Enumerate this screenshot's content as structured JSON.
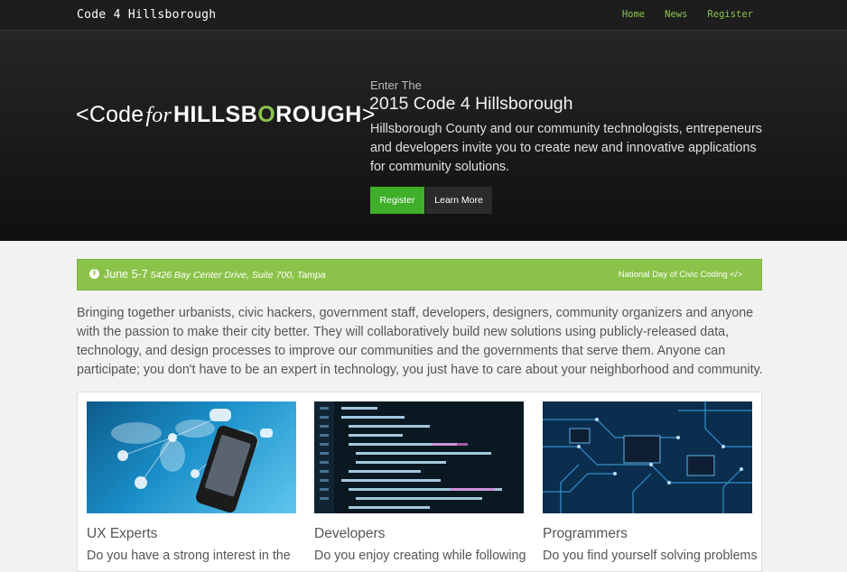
{
  "nav": {
    "brand": "Code 4 Hillsborough",
    "links": [
      "Home",
      "News",
      "Register"
    ]
  },
  "hero": {
    "logo": {
      "left_bracket": "<",
      "code": "Code",
      "for": "for",
      "hills_a": "HILLSB",
      "hills_o": "O",
      "hills_b": "ROUGH",
      "right_bracket": ">"
    },
    "kicker": "Enter The",
    "title": "2015 Code 4 Hillsborough",
    "text": "Hillsborough County and our community technologists, entrepeneurs and developers invite you to create new and innovative applications for community solutions.",
    "register_label": "Register",
    "learn_more_label": "Learn More"
  },
  "alert": {
    "icon": "info-icon",
    "date": "June 5-7",
    "address": "5426 Bay Center Drive, Suite 700, Tampa",
    "right_text": "National Day of Civic Coding </>"
  },
  "intro": "Bringing together urbanists, civic hackers, government staff, developers, designers, community organizers and anyone with the passion to make their city better. They will collaboratively build new solutions using publicly-released data, technology, and design processes to improve our communities and the governments that serve them. Anyone can participate; you don't have to be an expert in technology, you just have to care about your neighborhood and community.",
  "cards": [
    {
      "title": "UX Experts",
      "text": "Do you have a strong interest in the"
    },
    {
      "title": "Developers",
      "text": "Do you enjoy creating while following"
    },
    {
      "title": "Programmers",
      "text": "Do you find yourself solving problems"
    }
  ],
  "colors": {
    "accent": "#8ac44b",
    "register_button": "#3fae29",
    "alert_bg": "#8bc34a"
  }
}
